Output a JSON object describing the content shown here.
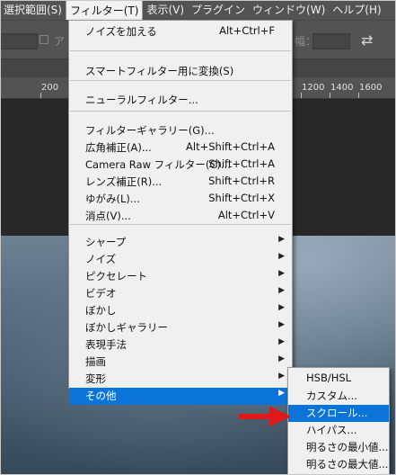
{
  "menubar": {
    "items": [
      {
        "label": "選択範囲(S)"
      },
      {
        "label": "フィルター(T)"
      },
      {
        "label": "表示(V)"
      },
      {
        "label": "プラグイン"
      },
      {
        "label": "ウィンドウ(W)"
      },
      {
        "label": "ヘルプ(H)"
      }
    ]
  },
  "options_bar": {
    "ghost_text_1": "ア",
    "ghost_text_2": "幅："
  },
  "ruler": {
    "ticks": [
      "200",
      "1200",
      "1400",
      "1600"
    ]
  },
  "filter_menu": {
    "groups": [
      [
        {
          "label": "ノイズを加える",
          "shortcut": "Alt+Ctrl+F"
        }
      ],
      [
        {
          "label": "スマートフィルター用に変換(S)",
          "shortcut": ""
        }
      ],
      [
        {
          "label": "ニューラルフィルター...",
          "shortcut": ""
        }
      ],
      [
        {
          "label": "フィルターギャラリー(G)...",
          "shortcut": ""
        },
        {
          "label": "広角補正(A)...",
          "shortcut": "Alt+Shift+Ctrl+A"
        },
        {
          "label": "Camera Raw フィルター(C)...",
          "shortcut": "Shift+Ctrl+A"
        },
        {
          "label": "レンズ補正(R)...",
          "shortcut": "Shift+Ctrl+R"
        },
        {
          "label": "ゆがみ(L)...",
          "shortcut": "Shift+Ctrl+X"
        },
        {
          "label": "消点(V)...",
          "shortcut": "Alt+Ctrl+V"
        }
      ],
      [
        {
          "label": "シャープ",
          "submenu": true
        },
        {
          "label": "ノイズ",
          "submenu": true
        },
        {
          "label": "ピクセレート",
          "submenu": true
        },
        {
          "label": "ビデオ",
          "submenu": true
        },
        {
          "label": "ぼかし",
          "submenu": true
        },
        {
          "label": "ぼかしギャラリー",
          "submenu": true
        },
        {
          "label": "表現手法",
          "submenu": true
        },
        {
          "label": "描画",
          "submenu": true
        },
        {
          "label": "変形",
          "submenu": true
        },
        {
          "label": "その他",
          "submenu": true,
          "highlighted": true
        }
      ]
    ]
  },
  "other_submenu": {
    "items": [
      {
        "label": "HSB/HSL"
      },
      {
        "label": "カスタム..."
      },
      {
        "label": "スクロール...",
        "highlighted": true
      },
      {
        "label": "ハイパス..."
      },
      {
        "label": "明るさの最小値..."
      },
      {
        "label": "明るさの最大値..."
      }
    ]
  },
  "colors": {
    "highlight": "#0a74d8",
    "arrow": "#e01818"
  }
}
